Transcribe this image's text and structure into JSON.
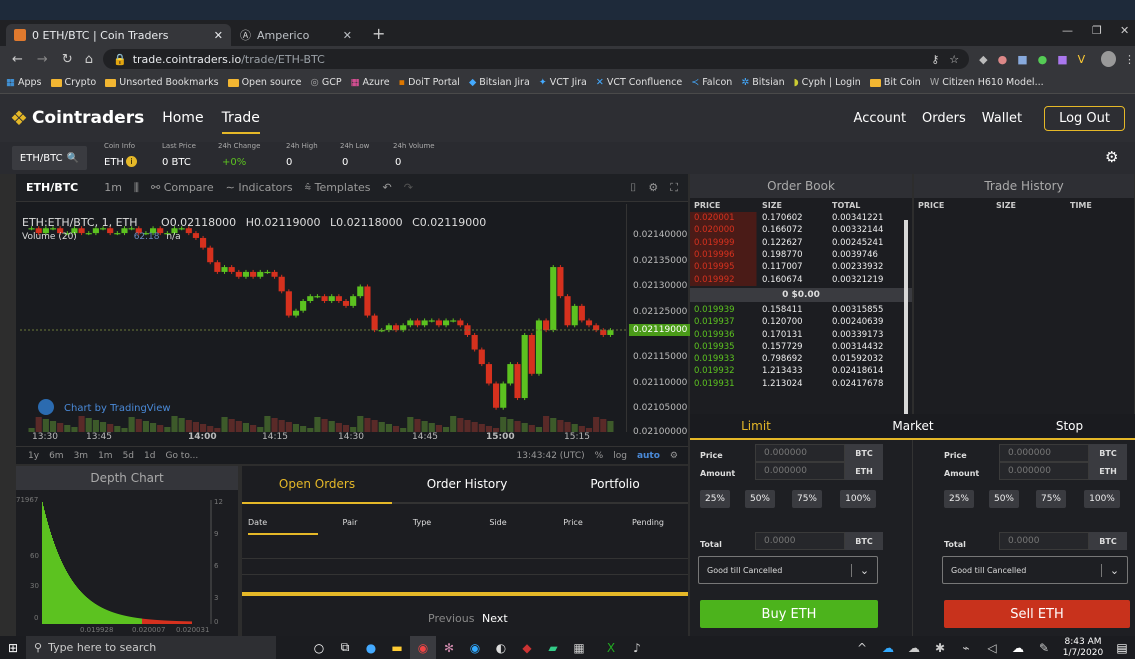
{
  "browser": {
    "tabs": [
      {
        "label": "0 ETH/BTC | Coin Traders",
        "active": true
      },
      {
        "label": "Amperico",
        "active": false
      }
    ],
    "url_host": "trade.cointraders.io",
    "url_path": "/trade/ETH-BTC",
    "bookmarks": [
      "Apps",
      "Crypto",
      "Unsorted Bookmarks",
      "Open source",
      "GCP",
      "Azure",
      "DoiT Portal",
      "Bitsian Jira",
      "VCT Jira",
      "VCT Confluence",
      "Falcon",
      "Bitsian",
      "Cyph | Login",
      "Bit Coin",
      "Citizen H610 Model..."
    ]
  },
  "app": {
    "brand": "Cointraders",
    "nav": [
      "Home",
      "Trade"
    ],
    "right_nav": [
      "Account",
      "Orders",
      "Wallet"
    ],
    "logout": "Log Out"
  },
  "ticker": {
    "pair": "ETH/BTC",
    "coin_info_label": "Coin Info",
    "coin": "ETH",
    "last_price_label": "Last Price",
    "last_price": "0 BTC",
    "change_label": "24h Change",
    "change": "+0%",
    "high_label": "24h High",
    "high": "0",
    "low_label": "24h Low",
    "low": "0",
    "volume_label": "24h Volume",
    "volume": "0"
  },
  "chart": {
    "pair": "ETH/BTC",
    "interval": "1m",
    "compare": "Compare",
    "indicators": "Indicators",
    "templates": "Templates",
    "legend_symbol": "ETH:ETH/BTC, 1, ETH",
    "ohlc": {
      "o": "O0.02118000",
      "h": "H0.02119000",
      "l": "L0.02118000",
      "c": "C0.02119000"
    },
    "volume_label": "Volume (20)",
    "volume_value": "62.18",
    "volume_na": "n/a",
    "watermark": "Chart by TradingView",
    "current_price": "0.02119000",
    "y_ticks": [
      "0.02140000",
      "0.02135000",
      "0.02130000",
      "0.02125000",
      "0.02115000",
      "0.02110000",
      "0.02105000",
      "0.02100000"
    ],
    "x_ticks": [
      "13:30",
      "13:45",
      "14:00",
      "14:15",
      "14:30",
      "14:45",
      "15:00",
      "15:15"
    ],
    "ranges": [
      "1y",
      "6m",
      "3m",
      "1m",
      "5d",
      "1d",
      "Go to..."
    ],
    "time_readout": "13:43:42 (UTC)",
    "pct": "%",
    "log": "log",
    "auto": "auto"
  },
  "order_book": {
    "title": "Order Book",
    "headers": [
      "PRICE",
      "SIZE",
      "TOTAL"
    ],
    "asks": [
      [
        "0.020001",
        "0.170602",
        "0.00341221"
      ],
      [
        "0.020000",
        "0.166072",
        "0.00332144"
      ],
      [
        "0.019999",
        "0.122627",
        "0.00245241"
      ],
      [
        "0.019996",
        "0.198770",
        "0.0039746"
      ],
      [
        "0.019995",
        "0.117007",
        "0.00233932"
      ],
      [
        "0.019992",
        "0.160674",
        "0.00321219"
      ]
    ],
    "spread": "0 $0.00",
    "bids": [
      [
        "0.019939",
        "0.158411",
        "0.00315855"
      ],
      [
        "0.019937",
        "0.120700",
        "0.00240639"
      ],
      [
        "0.019936",
        "0.170131",
        "0.00339173"
      ],
      [
        "0.019935",
        "0.157729",
        "0.00314432"
      ],
      [
        "0.019933",
        "0.798692",
        "0.01592032"
      ],
      [
        "0.019932",
        "1.213433",
        "0.02418614"
      ],
      [
        "0.019931",
        "1.213024",
        "0.02417678"
      ]
    ]
  },
  "trade_history": {
    "title": "Trade History",
    "headers": [
      "PRICE",
      "SIZE",
      "TIME"
    ]
  },
  "trade": {
    "tabs": [
      "Limit",
      "Market",
      "Stop"
    ],
    "buy": {
      "price_label": "Price",
      "price": "0.000000",
      "price_unit": "BTC",
      "amount_label": "Amount",
      "amount": "0.000000",
      "amount_unit": "ETH",
      "total_label": "Total",
      "total": "0.0000",
      "total_unit": "BTC",
      "tif": "Good till Cancelled",
      "button": "Buy ETH"
    },
    "sell": {
      "price_label": "Price",
      "price": "0.000000",
      "price_unit": "BTC",
      "amount_label": "Amount",
      "amount": "0.000000",
      "amount_unit": "ETH",
      "total_label": "Total",
      "total": "0.0000",
      "total_unit": "BTC",
      "tif": "Good till Cancelled",
      "button": "Sell ETH"
    },
    "percents": [
      "25%",
      "50%",
      "75%",
      "100%"
    ]
  },
  "depth": {
    "title": "Depth Chart",
    "y_left": [
      "71967",
      "60",
      "30",
      "0"
    ],
    "y_right": [
      "12",
      "9",
      "6",
      "3",
      "0"
    ],
    "x": [
      "0.019928",
      "0.020007",
      "0.020031"
    ]
  },
  "orders": {
    "tabs": [
      "Open Orders",
      "Order History",
      "Portfolio"
    ],
    "columns": [
      "Date",
      "Pair",
      "Type",
      "Side",
      "Price",
      "Pending"
    ],
    "previous": "Previous",
    "next": "Next"
  },
  "taskbar": {
    "search": "Type here to search",
    "time": "8:43 AM",
    "date": "1/7/2020"
  },
  "colors": {
    "accent": "#e5b828",
    "green": "#5cc220",
    "red": "#d6311e",
    "bg": "#2d2d2d"
  }
}
